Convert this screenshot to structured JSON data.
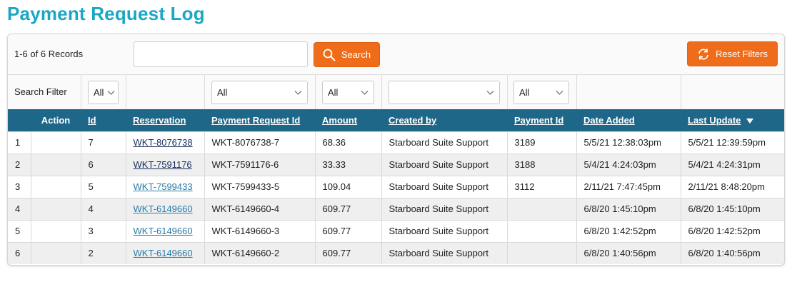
{
  "page": {
    "title": "Payment Request Log"
  },
  "toolbar": {
    "records": "1-6 of 6 Records",
    "search_value": "",
    "search_label": "Search",
    "reset_label": "Reset Filters"
  },
  "filters": {
    "label": "Search Filter",
    "id": "All",
    "payment_request_id": "All",
    "amount": "All",
    "created_by": "",
    "payment_id": "All"
  },
  "columns": [
    "",
    "Action",
    "Id",
    "Reservation",
    "Payment Request Id",
    "Amount",
    "Created by",
    "Payment Id",
    "Date Added",
    "Last Update"
  ],
  "rows": [
    {
      "n": "1",
      "action": "",
      "id": "7",
      "reservation": "WKT-8076738",
      "visited": true,
      "payment_request_id": "WKT-8076738-7",
      "amount": "68.36",
      "created_by": "Starboard Suite Support",
      "payment_id": "3189",
      "date_added": "5/5/21 12:38:03pm",
      "last_update": "5/5/21 12:39:59pm"
    },
    {
      "n": "2",
      "action": "",
      "id": "6",
      "reservation": "WKT-7591176",
      "visited": true,
      "payment_request_id": "WKT-7591176-6",
      "amount": "33.33",
      "created_by": "Starboard Suite Support",
      "payment_id": "3188",
      "date_added": "5/4/21 4:24:03pm",
      "last_update": "5/4/21 4:24:31pm"
    },
    {
      "n": "3",
      "action": "",
      "id": "5",
      "reservation": "WKT-7599433",
      "visited": false,
      "payment_request_id": "WKT-7599433-5",
      "amount": "109.04",
      "created_by": "Starboard Suite Support",
      "payment_id": "3112",
      "date_added": "2/11/21 7:47:45pm",
      "last_update": "2/11/21 8:48:20pm"
    },
    {
      "n": "4",
      "action": "",
      "id": "4",
      "reservation": "WKT-6149660",
      "visited": false,
      "payment_request_id": "WKT-6149660-4",
      "amount": "609.77",
      "created_by": "Starboard Suite Support",
      "payment_id": "",
      "date_added": "6/8/20 1:45:10pm",
      "last_update": "6/8/20 1:45:10pm"
    },
    {
      "n": "5",
      "action": "",
      "id": "3",
      "reservation": "WKT-6149660",
      "visited": false,
      "payment_request_id": "WKT-6149660-3",
      "amount": "609.77",
      "created_by": "Starboard Suite Support",
      "payment_id": "",
      "date_added": "6/8/20 1:42:52pm",
      "last_update": "6/8/20 1:42:52pm"
    },
    {
      "n": "6",
      "action": "",
      "id": "2",
      "reservation": "WKT-6149660",
      "visited": false,
      "payment_request_id": "WKT-6149660-2",
      "amount": "609.77",
      "created_by": "Starboard Suite Support",
      "payment_id": "",
      "date_added": "6/8/20 1:40:56pm",
      "last_update": "6/8/20 1:40:56pm"
    }
  ],
  "colors": {
    "accent": "#1aa7c5",
    "button": "#ef6c1a",
    "header": "#1f6788",
    "link": "#2a7ba8",
    "link_visited": "#1a2f5c"
  },
  "icons": {
    "search": "search-icon",
    "reset": "refresh-icon",
    "sort": "sort-desc-icon",
    "select": "chevron-down-icon"
  }
}
